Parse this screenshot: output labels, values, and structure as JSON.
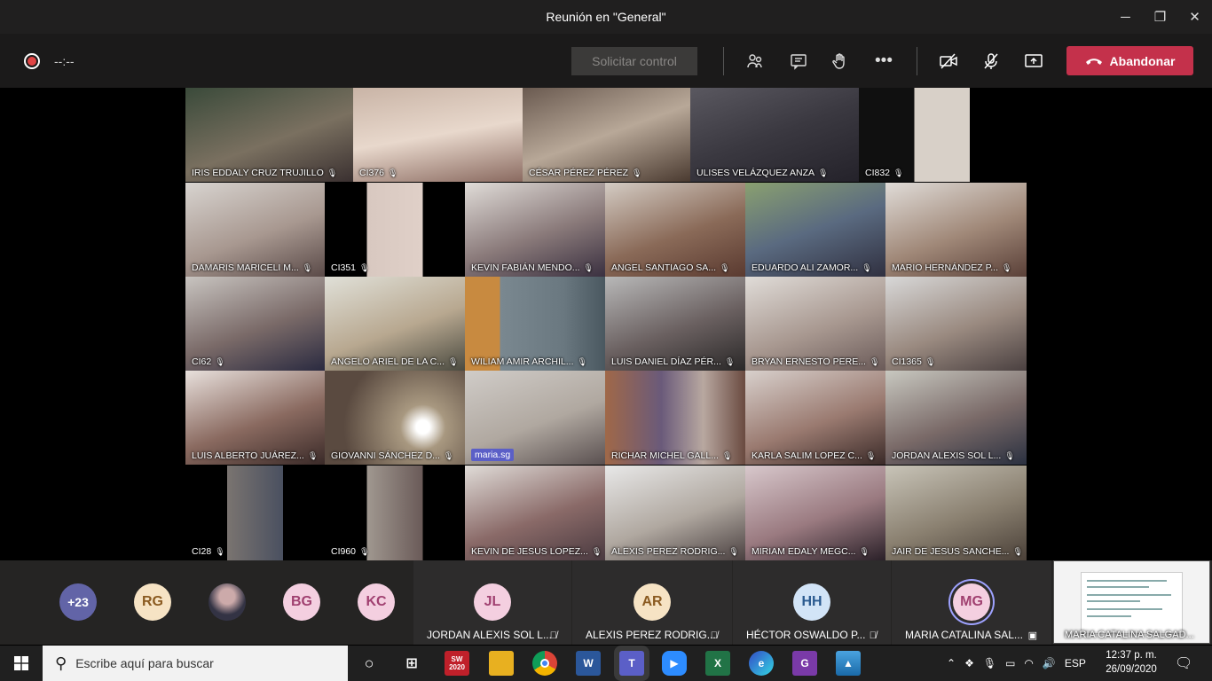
{
  "window": {
    "title": "Reunión en \"General\"",
    "minimize": "─",
    "maximize": "❐",
    "close": "✕"
  },
  "toolbar": {
    "timer": "--:--",
    "request_control": "Solicitar control",
    "participants_icon": "people-icon",
    "chat_icon": "chat-icon",
    "raise_hand_icon": "hand-icon",
    "more": "•••",
    "camera_icon": "camera-off-icon",
    "mic_icon": "mic-off-icon",
    "share_icon": "share-screen-icon",
    "leave_label": "Abandonar",
    "leave_color": "#c4314b"
  },
  "tiles": [
    {
      "label": "IRIS EDDALY CRUZ TRUJILLO"
    },
    {
      "label": "CI376"
    },
    {
      "label": "CÉSAR PÉREZ  PÉREZ"
    },
    {
      "label": "ULISES VELÁZQUEZ  ANZA"
    },
    {
      "label": "CI832"
    },
    {
      "label": "DAMARIS MARICELI M..."
    },
    {
      "label": "CI351"
    },
    {
      "label": "KEVIN FABIÁN MENDO..."
    },
    {
      "label": "ANGEL SANTIAGO SA..."
    },
    {
      "label": "EDUARDO ALI ZAMOR..."
    },
    {
      "label": "MARIO HERNÁNDEZ P..."
    },
    {
      "label": "CI62"
    },
    {
      "label": "ANGELO ARIEL DE LA C..."
    },
    {
      "label": "WILIAM AMIR ARCHIL..."
    },
    {
      "label": "LUIS DANIEL DÍAZ PÉR..."
    },
    {
      "label": "BRYAN ERNESTO PERE..."
    },
    {
      "label": "CI1365"
    },
    {
      "label": "LUIS ALBERTO JUÁREZ..."
    },
    {
      "label": "GIOVANNI SÁNCHEZ D..."
    },
    {
      "label": "maria.sg"
    },
    {
      "label": "RICHAR MICHEL GALL..."
    },
    {
      "label": "KARLA SALIM LOPEZ C..."
    },
    {
      "label": "JORDAN ALEXIS SOL L..."
    },
    {
      "label": "CI28"
    },
    {
      "label": "CI960"
    },
    {
      "label": "KEVIN DE JESUS LOPEZ..."
    },
    {
      "label": "ALEXIS PEREZ RODRIG..."
    },
    {
      "label": "MIRIAM EDALY MEGC..."
    },
    {
      "label": "JAIR DE JESUS SANCHE..."
    }
  ],
  "strip": {
    "overflow": "+23",
    "avatars": [
      "RG",
      "BG",
      "KC"
    ],
    "panes": [
      {
        "initials": "JL",
        "name": "JORDAN ALEXIS SOL L..."
      },
      {
        "initials": "AR",
        "name": "ALEXIS PEREZ RODRIG..."
      },
      {
        "initials": "HH",
        "name": "HÉCTOR OSWALDO P..."
      },
      {
        "initials": "MG",
        "name": "MARIA CATALINA SAL..."
      }
    ],
    "shared_caption": "MARIA CATALINA SALGAD..."
  },
  "taskbar": {
    "search_placeholder": "Escribe aquí para buscar",
    "sw_label": "2020",
    "language": "ESP",
    "time": "12:37 p. m.",
    "date": "26/09/2020"
  },
  "colors": {
    "avatar_purple": "#6264a7",
    "avatar_cream": "#f6e3c4",
    "avatar_pink": "#f4cfe0",
    "avatar_blue": "#d2e4f7"
  }
}
